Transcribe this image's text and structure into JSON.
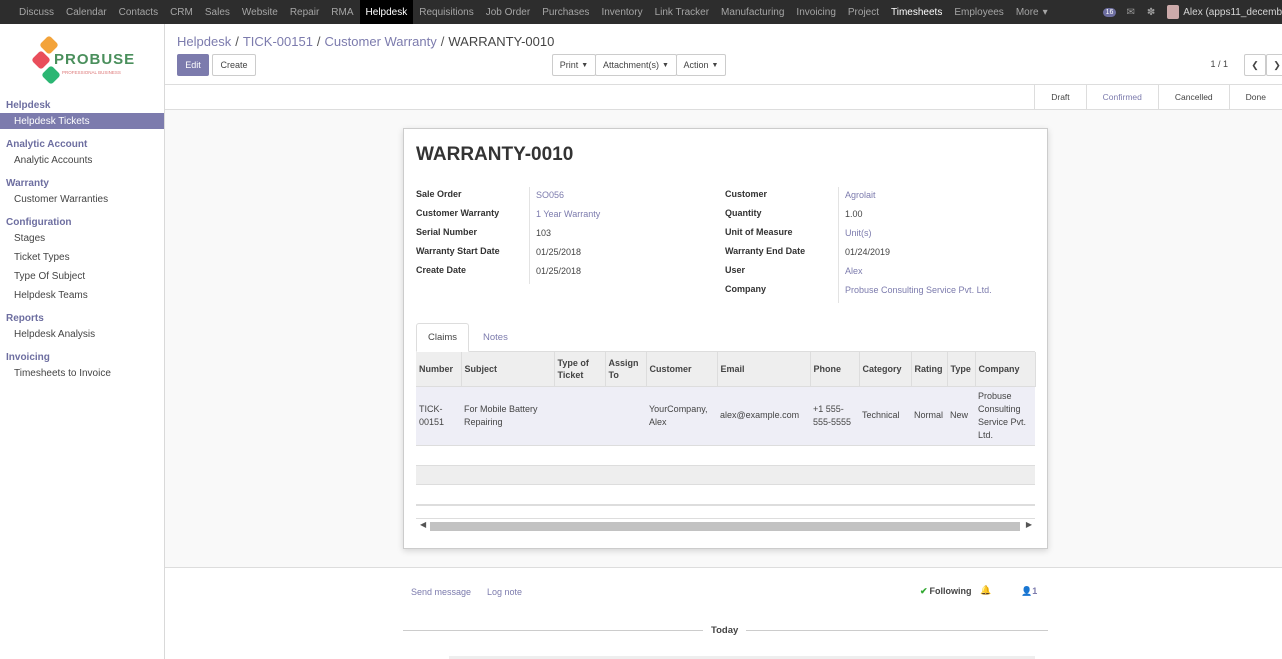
{
  "topnav": {
    "items": [
      "Discuss",
      "Calendar",
      "Contacts",
      "CRM",
      "Sales",
      "Website",
      "Repair",
      "RMA",
      "Helpdesk",
      "Requisitions",
      "Job Order",
      "Purchases",
      "Inventory",
      "Link Tracker",
      "Manufacturing",
      "Invoicing",
      "Project",
      "Timesheets",
      "Employees",
      "More"
    ],
    "active": "Helpdesk",
    "badge": "16",
    "user": "Alex (apps11_decemb"
  },
  "logo": {
    "text": "PROBUSE",
    "sub": "PROFESSIONAL BUSINESS"
  },
  "sidebar": {
    "sections": [
      {
        "title": "Helpdesk",
        "items": [
          "Helpdesk Tickets"
        ]
      },
      {
        "title": "Analytic Account",
        "items": [
          "Analytic Accounts"
        ]
      },
      {
        "title": "Warranty",
        "items": [
          "Customer Warranties"
        ]
      },
      {
        "title": "Configuration",
        "items": [
          "Stages",
          "Ticket Types",
          "Type Of Subject",
          "Helpdesk Teams"
        ]
      },
      {
        "title": "Reports",
        "items": [
          "Helpdesk Analysis"
        ]
      },
      {
        "title": "Invoicing",
        "items": [
          "Timesheets to Invoice"
        ]
      }
    ]
  },
  "breadcrumb": {
    "b1": "Helpdesk",
    "b2": "TICK-00151",
    "b3": "Customer Warranty",
    "current": "WARRANTY-0010",
    "sep": "/"
  },
  "toolbar": {
    "edit": "Edit",
    "create": "Create",
    "print": "Print",
    "attachments": "Attachment(s)",
    "action": "Action",
    "pager": "1 / 1"
  },
  "stages": [
    "Draft",
    "Confirmed",
    "Cancelled",
    "Done"
  ],
  "active_stage": "Confirmed",
  "record": {
    "title": "WARRANTY-0010",
    "left": [
      {
        "label": "Sale Order",
        "value": "SO056",
        "link": true
      },
      {
        "label": "Customer Warranty",
        "value": "1 Year Warranty",
        "link": true
      },
      {
        "label": "Serial Number",
        "value": "103",
        "link": false
      },
      {
        "label": "Warranty Start Date",
        "value": "01/25/2018",
        "link": false
      },
      {
        "label": "Create Date",
        "value": "01/25/2018",
        "link": false
      }
    ],
    "right": [
      {
        "label": "Customer",
        "value": "Agrolait",
        "link": true
      },
      {
        "label": "Quantity",
        "value": "1.00",
        "link": false
      },
      {
        "label": "Unit of Measure",
        "value": "Unit(s)",
        "link": true
      },
      {
        "label": "Warranty End Date",
        "value": "01/24/2019",
        "link": false
      },
      {
        "label": "User",
        "value": "Alex",
        "link": true
      },
      {
        "label": "Company",
        "value": "Probuse Consulting Service Pvt. Ltd.",
        "link": true
      }
    ]
  },
  "tabs": {
    "claims": "Claims",
    "notes": "Notes"
  },
  "claims": {
    "headers": [
      "Number",
      "Subject",
      "Type of Ticket",
      "Assign To",
      "Customer",
      "Email",
      "Phone",
      "Category",
      "Rating",
      "Type",
      "Company"
    ],
    "rows": [
      [
        "TICK-00151",
        "For Mobile Battery Repairing",
        "",
        "",
        "YourCompany, Alex",
        "alex@example.com",
        "+1 555-555-5555",
        "Technical",
        "Normal",
        "New",
        "Probuse Consulting Service Pvt. Ltd."
      ]
    ]
  },
  "chatter": {
    "send": "Send message",
    "log": "Log note",
    "following": "Following",
    "followers": "1",
    "today": "Today"
  }
}
